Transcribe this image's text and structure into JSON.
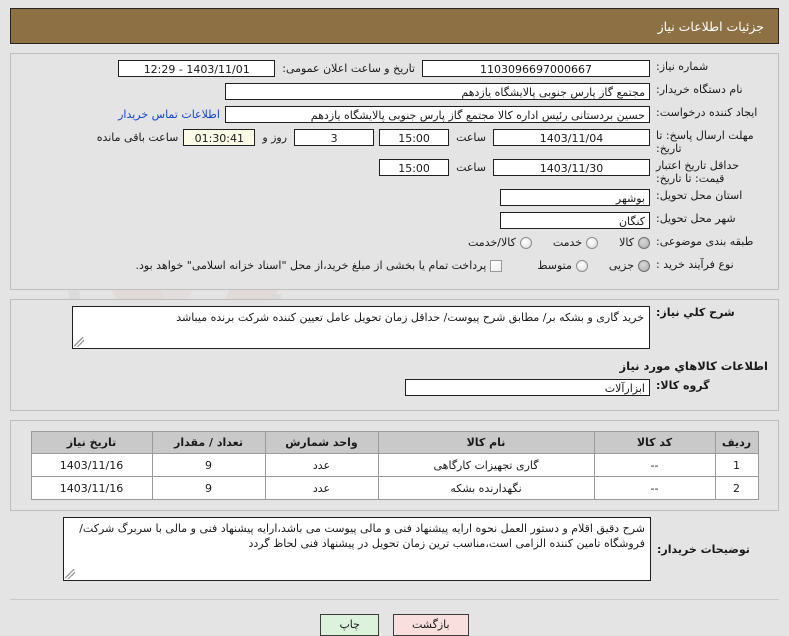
{
  "header": {
    "title": "جزئیات اطلاعات نیاز"
  },
  "form": {
    "need_number_label": "شماره نیاز:",
    "need_number_value": "1103096697000667",
    "announce_label": "تاریخ و ساعت اعلان عمومی:",
    "announce_value": "1403/11/01 - 12:29",
    "buyer_org_label": "نام دستگاه خریدار:",
    "buyer_org_value": "مجتمع گاز پارس جنوبی  پالایشگاه یازدهم",
    "creator_label": "ایجاد کننده درخواست:",
    "creator_value": "حسین بردستانی رئیس اداره کالا مجتمع گاز پارس جنوبی  پالایشگاه یازدهم",
    "contact_link": "اطلاعات تماس خریدار",
    "deadline_label": "مهلت ارسال پاسخ: تا تاریخ:",
    "deadline_date": "1403/11/04",
    "deadline_hour_label": "ساعت",
    "deadline_time": "15:00",
    "remaining_days": "3",
    "remaining_days_label": "روز و",
    "remaining_clock": "01:30:41",
    "remaining_suffix": "ساعت باقی مانده",
    "price_validity_label": "حداقل تاریخ اعتبار قیمت: تا تاریخ:",
    "price_validity_date": "1403/11/30",
    "price_validity_hour_label": "ساعت",
    "price_validity_time": "15:00",
    "province_label": "استان محل تحویل:",
    "province_value": "بوشهر",
    "city_label": "شهر محل تحویل:",
    "city_value": "کنگان",
    "subject_class_label": "طبقه بندی موضوعی:",
    "subject_options": [
      {
        "label": "کالا",
        "selected": true
      },
      {
        "label": "خدمت",
        "selected": false
      },
      {
        "label": "کالا/خدمت",
        "selected": false
      }
    ],
    "process_type_label": "نوع فرآیند خرید :",
    "process_options": [
      {
        "label": "جزیی",
        "selected": true
      },
      {
        "label": "متوسط",
        "selected": false
      }
    ],
    "treasury_checkbox_checked": false,
    "treasury_note": "پرداخت تمام یا بخشی از مبلغ خرید،از محل \"اسناد خزانه اسلامی\" خواهد بود."
  },
  "summary": {
    "label": "شرح کلي نیاز:",
    "value": "خرید گاری و بشکه بر/ مطابق شرح پیوست/ حداقل زمان تحویل عامل تعیین کننده شرکت برنده میباشد"
  },
  "goods": {
    "section_title": "اطلاعات کالاهاي مورد نیاز",
    "group_label": "گروه کالا:",
    "group_value": "ابزارآلات",
    "columns": [
      "ردیف",
      "کد کالا",
      "نام کالا",
      "واحد شمارش",
      "تعداد / مقدار",
      "تاریخ نیاز"
    ],
    "rows": [
      {
        "row": "1",
        "code": "--",
        "name": "گاری تجهیزات کارگاهی",
        "unit": "عدد",
        "qty": "9",
        "date": "1403/11/16"
      },
      {
        "row": "2",
        "code": "--",
        "name": "نگهدارنده بشکه",
        "unit": "عدد",
        "qty": "9",
        "date": "1403/11/16"
      }
    ]
  },
  "buyer_note": {
    "label": "توضیحات خریدار:",
    "value": "شرح دقیق اقلام و دستور العمل نحوه ارایه پیشنهاد فنی و مالی پیوست می باشد،ارایه پیشنهاد فنی و مالی با سربرگ شرکت/فروشگاه تامین کننده الزامی است،مناسب ترین زمان تحویل در پیشنهاد فنی لحاظ گردد"
  },
  "footer": {
    "print_label": "چاپ",
    "back_label": "بازگشت"
  },
  "watermark": {
    "text": "ariatender.net"
  },
  "colors": {
    "header_brown": "#8d7043",
    "page_bg": "#e4e4e4",
    "link_blue": "#1346c8",
    "table_header_gray": "#c9c9c9",
    "print_green": "#ddf2dd",
    "back_pink": "#fadfdf",
    "cream_field": "#fbfbe8"
  }
}
